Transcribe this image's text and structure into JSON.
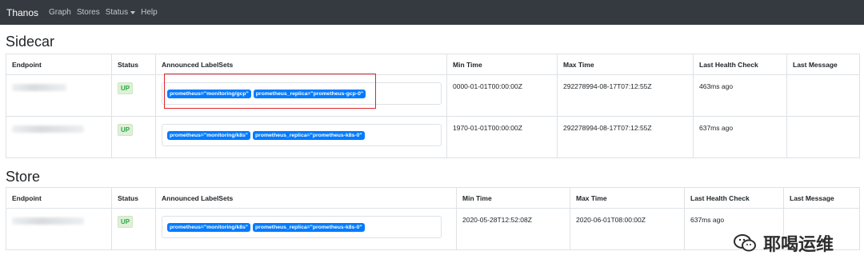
{
  "navbar": {
    "brand": "Thanos",
    "links": [
      "Graph",
      "Stores",
      "Status",
      "Help"
    ]
  },
  "sidecar": {
    "title": "Sidecar",
    "headers": [
      "Endpoint",
      "Status",
      "Announced LabelSets",
      "Min Time",
      "Max Time",
      "Last Health Check",
      "Last Message"
    ],
    "rows": [
      {
        "status": "UP",
        "labels": [
          "prometheus=\"monitoring/gcp\"",
          "prometheus_replica=\"prometheus-gcp-0\""
        ],
        "min_time": "0000-01-01T00:00:00Z",
        "max_time": "292278994-08-17T07:12:55Z",
        "health": "463ms ago",
        "message": ""
      },
      {
        "status": "UP",
        "labels": [
          "prometheus=\"monitoring/k8s\"",
          "prometheus_replica=\"prometheus-k8s-0\""
        ],
        "min_time": "1970-01-01T00:00:00Z",
        "max_time": "292278994-08-17T07:12:55Z",
        "health": "637ms ago",
        "message": ""
      }
    ]
  },
  "store": {
    "title": "Store",
    "headers": [
      "Endpoint",
      "Status",
      "Announced LabelSets",
      "Min Time",
      "Max Time",
      "Last Health Check",
      "Last Message"
    ],
    "rows": [
      {
        "status": "UP",
        "labels": [
          "prometheus=\"monitoring/k8s\"",
          "prometheus_replica=\"prometheus-k8s-0\""
        ],
        "min_time": "2020-05-28T12:52:08Z",
        "max_time": "2020-06-01T08:00:00Z",
        "health": "637ms ago",
        "message": ""
      }
    ]
  },
  "watermark": {
    "text": "耶喝运维",
    "icon": "wechat-icon"
  },
  "colors": {
    "navbar": "#343a40",
    "label": "#007bff",
    "up_badge": "#28a745",
    "highlight": "#e0262b"
  }
}
